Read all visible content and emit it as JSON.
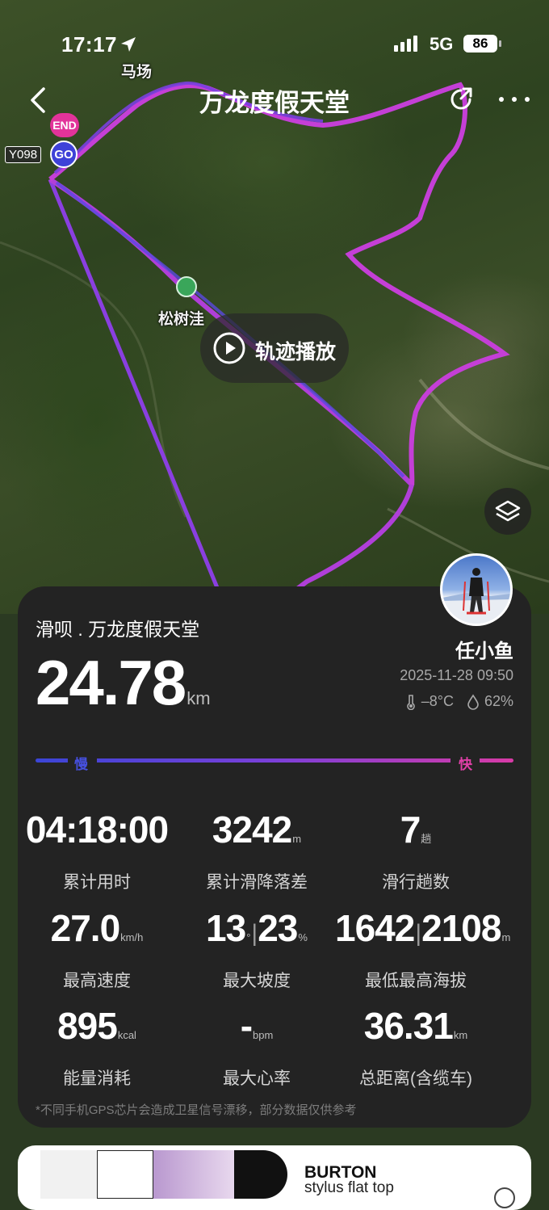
{
  "status_bar": {
    "time": "17:17",
    "network": "5G",
    "battery": "86"
  },
  "header": {
    "title": "万龙度假天堂",
    "icons": [
      "back-arrow-icon",
      "share-icon",
      "more-icon"
    ]
  },
  "map": {
    "labels": {
      "horse_farm": "马场",
      "songshuwa": "松树洼",
      "road_tag": "Y098"
    },
    "pins": {
      "end": "END",
      "go": "GO"
    },
    "playback_label": "轨迹播放",
    "track_colors": {
      "slow": "#3b45d6",
      "mid": "#9a3de0",
      "fast": "#e03fc0"
    }
  },
  "card": {
    "resort_name": "滑呗 . 万龙度假天堂",
    "username": "任小鱼",
    "distance": {
      "value": "24.78",
      "unit": "km"
    },
    "datetime": "2025-11-28 09:50",
    "temperature": "–8°C",
    "humidity": "62%",
    "speed_legend": {
      "slow": "慢",
      "fast": "快"
    },
    "stats": {
      "total_time": {
        "value": "04:18:00",
        "unit": "",
        "label": "累计用时"
      },
      "total_drop": {
        "value": "3242",
        "unit": "m",
        "label": "累计滑降落差"
      },
      "runs": {
        "value": "7",
        "unit": "趟",
        "label": "滑行趟数"
      },
      "max_speed": {
        "value": "27.0",
        "unit": "km/h",
        "label": "最高速度"
      },
      "max_slope": {
        "value_a": "13",
        "unit_a": "°",
        "value_b": "23",
        "unit_b": "%",
        "label": "最大坡度"
      },
      "altitude": {
        "value_a": "1642",
        "value_b": "2108",
        "unit": "m",
        "label": "最低最高海拔"
      },
      "energy": {
        "value": "895",
        "unit": "kcal",
        "label": "能量消耗"
      },
      "heart_rate": {
        "value": "-",
        "unit": "bpm",
        "label": "最大心率"
      },
      "total_distance": {
        "value": "36.31",
        "unit": "km",
        "label": "总距离(含缆车)"
      }
    },
    "disclaimer": "*不同手机GPS芯片会造成卫星信号漂移，部分数据仅供参考"
  },
  "ad": {
    "brand": "BURTON",
    "product": "stylus flat top"
  }
}
